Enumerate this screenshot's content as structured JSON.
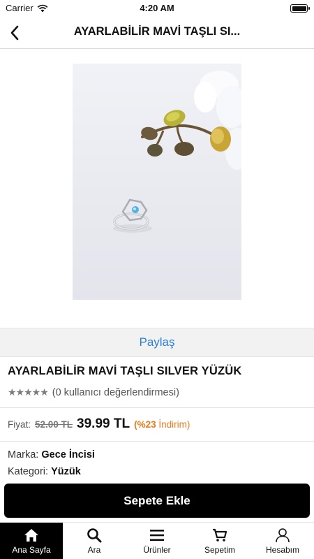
{
  "status_bar": {
    "carrier": "Carrier",
    "time": "4:20 AM"
  },
  "nav": {
    "title": "AYARLABİLİR MAVİ TAŞLI SI...",
    "back_icon": "chevron-left-icon"
  },
  "product": {
    "image_alt": "product photo",
    "share_label": "Paylaş",
    "name": "AYARLABİLİR MAVİ TAŞLI SILVER YÜZÜK",
    "stars": "★★★★★",
    "rating_text": "(0 kullanıcı değerlendirmesi)",
    "rating_value": 0,
    "rating_max": 5,
    "price_label": "Fiyat:",
    "old_price": "52.00 TL",
    "new_price": "39.99 TL",
    "discount_prefix": "(%23",
    "discount_suffix": " İndirim)",
    "brand_label": "Marka:",
    "brand_value": "Gece İncisi",
    "category_label": "Kategori:",
    "category_value": "Yüzük",
    "add_to_cart": "Sepete Ekle"
  },
  "tabs": [
    {
      "label": "Ana Sayfa",
      "icon": "home-icon",
      "active": true
    },
    {
      "label": "Ara",
      "icon": "search-icon",
      "active": false
    },
    {
      "label": "Ürünler",
      "icon": "menu-icon",
      "active": false
    },
    {
      "label": "Sepetim",
      "icon": "cart-icon",
      "active": false
    },
    {
      "label": "Hesabım",
      "icon": "user-icon",
      "active": false
    }
  ],
  "colors": {
    "accent_link": "#2a7fd6",
    "discount": "#ec7a1c",
    "star": "#7d7d7d",
    "button": "#000000"
  }
}
